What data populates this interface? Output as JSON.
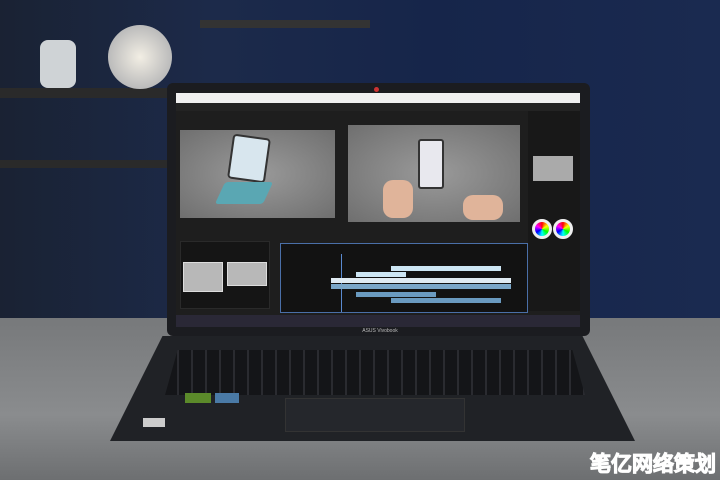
{
  "laptop": {
    "brand": "ASUS Vivobook"
  },
  "screen": {
    "app": "video-editor",
    "content": "dual monitor previews of foldable phone, timeline with clips, color wheels"
  },
  "watermark": "笔亿网络策划",
  "colors": {
    "wall": "#1c2a4a",
    "table": "#8a8c8e",
    "laptop": "#1b1c20",
    "timeline_border": "#4a6fa8",
    "clip": "#cde6f4"
  }
}
